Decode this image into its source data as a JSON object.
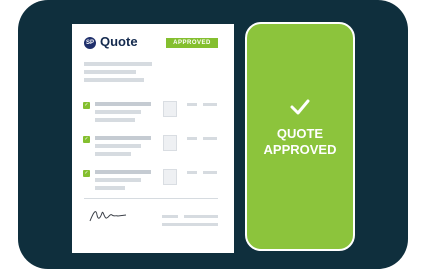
{
  "document": {
    "logo_mark": "SP",
    "logo_text": "Quote",
    "badge": "APPROVED",
    "line_items": [
      {
        "checked": true
      },
      {
        "checked": true
      },
      {
        "checked": true
      }
    ]
  },
  "phone": {
    "line1": "QUOTE",
    "line2": "APPROVED"
  },
  "colors": {
    "background_panel": "#0f2f3d",
    "accent_green": "#84bf2f",
    "phone_green": "#8cc43c",
    "logo_navy": "#142a4e"
  },
  "icons": [
    "check-icon",
    "signature-icon",
    "logo-icon"
  ]
}
